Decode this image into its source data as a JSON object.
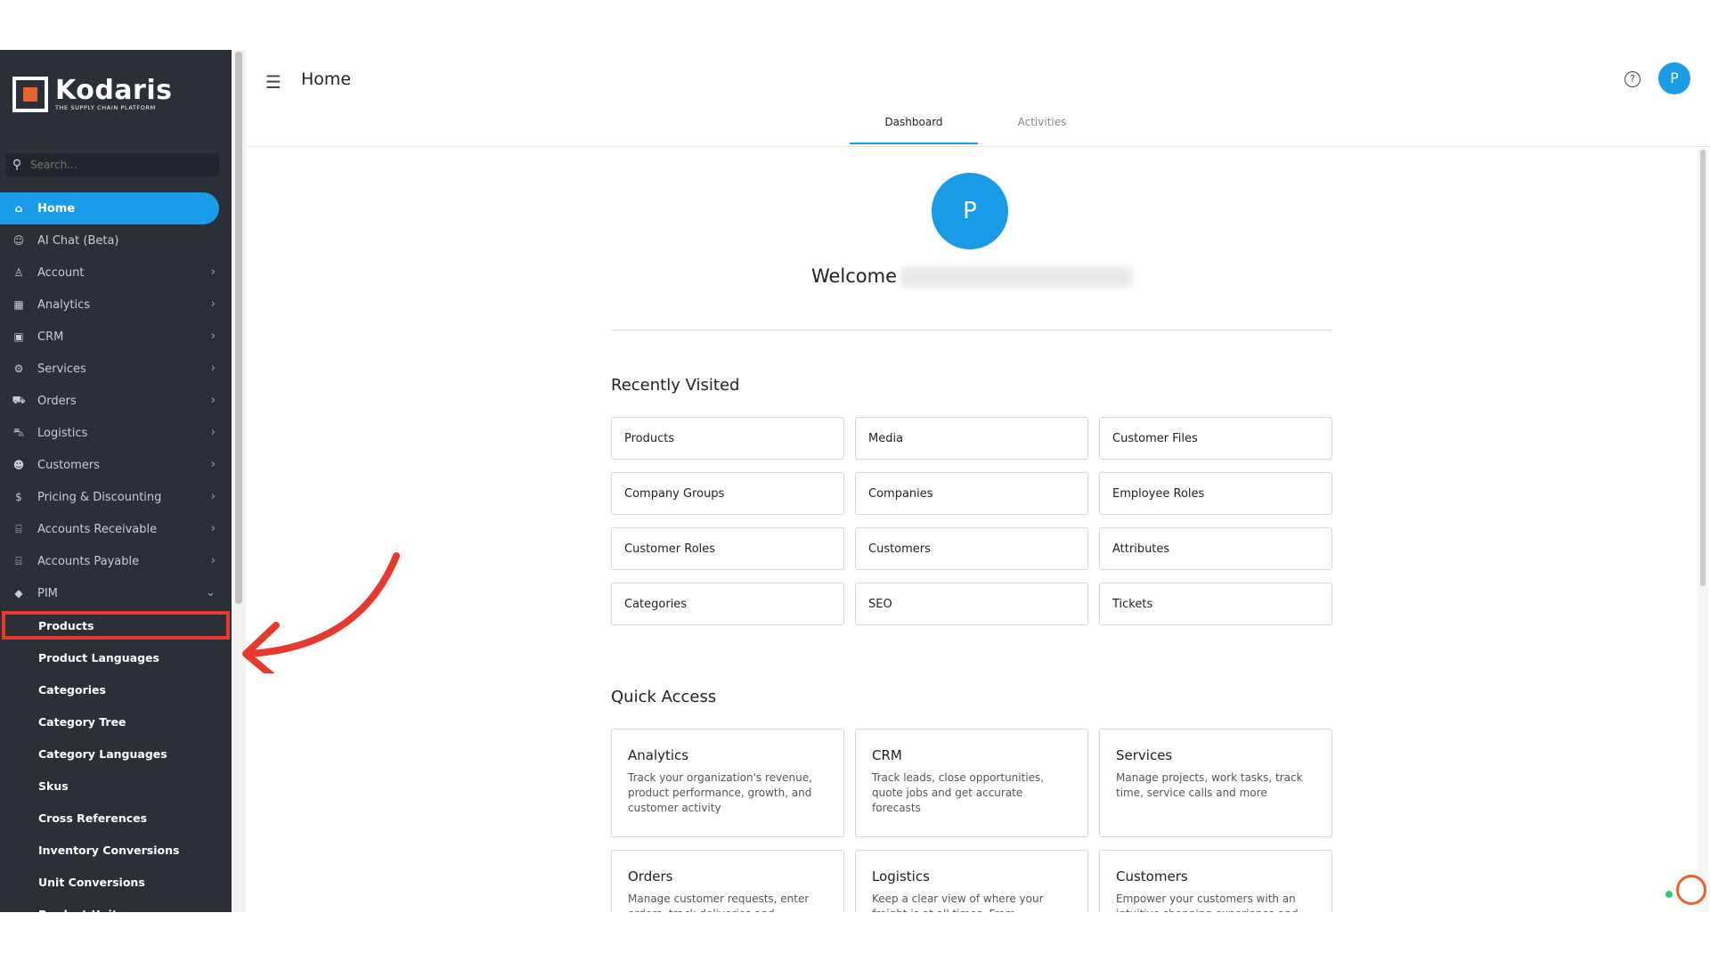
{
  "sidebar": {
    "logo_name": "Kodaris",
    "logo_tagline": "THE SUPPLY CHAIN PLATFORM",
    "search_placeholder": "Search...",
    "items": [
      {
        "label": "Home",
        "icon": "home-icon",
        "glyph": "⌂"
      },
      {
        "label": "AI Chat (Beta)",
        "icon": "robot-icon",
        "glyph": "☺"
      },
      {
        "label": "Account",
        "icon": "user-icon",
        "glyph": "♙"
      },
      {
        "label": "Analytics",
        "icon": "chart-icon",
        "glyph": "▦"
      },
      {
        "label": "CRM",
        "icon": "contact-card-icon",
        "glyph": "▣"
      },
      {
        "label": "Services",
        "icon": "gears-icon",
        "glyph": "⚙"
      },
      {
        "label": "Orders",
        "icon": "truck-icon",
        "glyph": "⛟"
      },
      {
        "label": "Logistics",
        "icon": "shipping-icon",
        "glyph": "⛍"
      },
      {
        "label": "Customers",
        "icon": "people-icon",
        "glyph": "☻"
      },
      {
        "label": "Pricing & Discounting",
        "icon": "dollar-icon",
        "glyph": "$"
      },
      {
        "label": "Accounts Receivable",
        "icon": "bank-icon",
        "glyph": "⌸"
      },
      {
        "label": "Accounts Payable",
        "icon": "bank-icon",
        "glyph": "⌸"
      },
      {
        "label": "PIM",
        "icon": "tag-icon",
        "glyph": "◆"
      }
    ],
    "pim_subitems": [
      "Products",
      "Product Languages",
      "Categories",
      "Category Tree",
      "Category Languages",
      "Skus",
      "Cross References",
      "Inventory Conversions",
      "Unit Conversions",
      "Product Units"
    ]
  },
  "header": {
    "title": "Home",
    "avatar_letter": "P"
  },
  "tabs": [
    "Dashboard",
    "Activities"
  ],
  "welcome": {
    "avatar_letter": "P",
    "text": "Welcome"
  },
  "recently_visited": {
    "title": "Recently Visited",
    "items": [
      "Products",
      "Media",
      "Customer Files",
      "Company Groups",
      "Companies",
      "Employee Roles",
      "Customer Roles",
      "Customers",
      "Attributes",
      "Categories",
      "SEO",
      "Tickets"
    ]
  },
  "quick_access": {
    "title": "Quick Access",
    "items": [
      {
        "title": "Analytics",
        "desc": "Track your organization's revenue, product performance, growth, and customer activity"
      },
      {
        "title": "CRM",
        "desc": "Track leads, close opportunities, quote jobs and get accurate forecasts"
      },
      {
        "title": "Services",
        "desc": "Manage projects, work tasks, track time, service calls and more"
      },
      {
        "title": "Orders",
        "desc": "Manage customer requests, enter orders, track deliveries and"
      },
      {
        "title": "Logistics",
        "desc": "Keep a clear view of where your freight is at all times. From"
      },
      {
        "title": "Customers",
        "desc": "Empower your customers with an intuitive shopping experience and"
      }
    ]
  },
  "colors": {
    "accent": "#1a9be8",
    "sidebar_bg": "#2b2f38",
    "highlight": "#e83a2c",
    "brand_orange": "#e8622c"
  }
}
